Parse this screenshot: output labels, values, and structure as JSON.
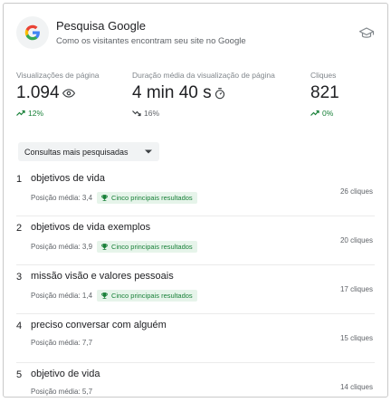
{
  "header": {
    "title": "Pesquisa Google",
    "subtitle": "Como os visitantes encontram seu site no Google"
  },
  "metrics": [
    {
      "label": "Visualizações de página",
      "value": "1.094",
      "icon": "eye-icon",
      "change": "12%",
      "trend": "up"
    },
    {
      "label": "Duração média da visualização de página",
      "value": "4 min 40 s",
      "icon": "timer-icon",
      "change": "16%",
      "trend": "down"
    },
    {
      "label": "Cliques",
      "value": "821",
      "icon": "",
      "change": "0%",
      "trend": "up"
    }
  ],
  "dropdown": {
    "label": "Consultas mais pesquisadas"
  },
  "queries": [
    {
      "rank": "1",
      "text": "objetivos de vida",
      "position": "Posição média: 3,4",
      "badge": "Cinco principais resultados",
      "clicks": "26 cliques"
    },
    {
      "rank": "2",
      "text": "objetivos de vida exemplos",
      "position": "Posição média: 3,9",
      "badge": "Cinco principais resultados",
      "clicks": "20 cliques"
    },
    {
      "rank": "3",
      "text": "missão visão e valores pessoais",
      "position": "Posição média: 1,4",
      "badge": "Cinco principais resultados",
      "clicks": "17 cliques"
    },
    {
      "rank": "4",
      "text": "preciso conversar com alguém",
      "position": "Posição média: 7,7",
      "badge": "",
      "clicks": "15 cliques"
    },
    {
      "rank": "5",
      "text": "objetivo de vida",
      "position": "Posição média: 5,7",
      "badge": "",
      "clicks": "14 cliques"
    }
  ],
  "colors": {
    "positive": "#188038",
    "badge_bg": "#e6f4ea",
    "google_blue": "#4285f4"
  }
}
